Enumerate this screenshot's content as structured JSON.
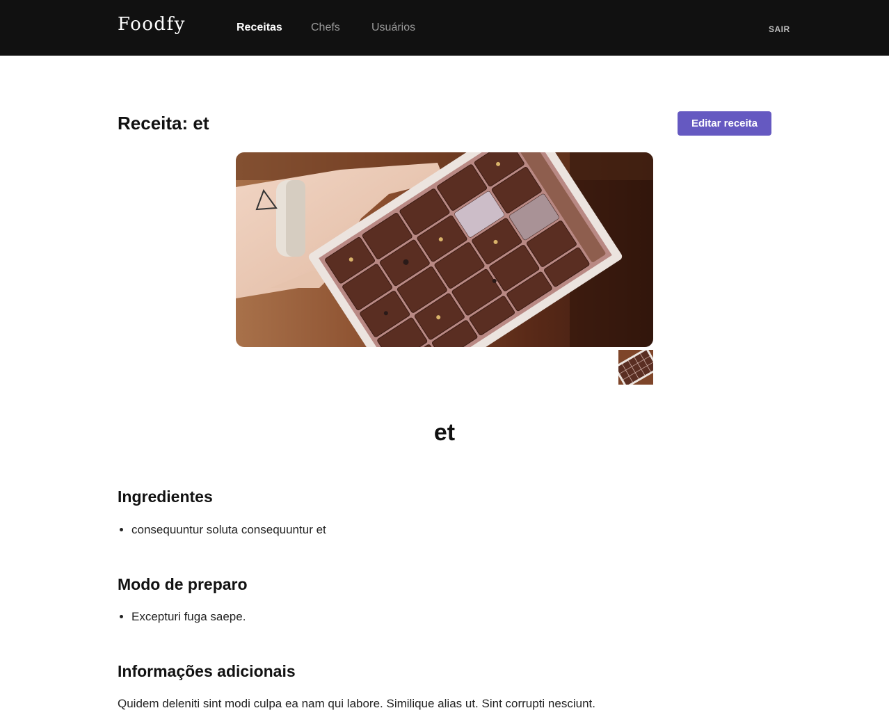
{
  "header": {
    "logo": "Foodfy",
    "nav": [
      {
        "label": "Receitas",
        "active": true
      },
      {
        "label": "Chefs",
        "active": false
      },
      {
        "label": "Usuários",
        "active": false
      }
    ],
    "logout_label": "SAIR"
  },
  "page": {
    "title": "Receita: et",
    "edit_button_label": "Editar receita"
  },
  "gallery": {
    "main_image_icon": "chocolate-box-photo",
    "thumbnails": 1
  },
  "recipe": {
    "name": "et",
    "ingredients_title": "Ingredientes",
    "ingredients": [
      "consequuntur soluta consequuntur et"
    ],
    "preparation_title": "Modo de preparo",
    "preparation": [
      "Excepturi fuga saepe."
    ],
    "info_title": "Informações adicionais",
    "info_text": "Quidem deleniti sint modi culpa ea nam qui labore. Similique alias ut. Sint corrupti nesciunt."
  },
  "colors": {
    "header_bg": "#111111",
    "accent": "#6559c1"
  }
}
